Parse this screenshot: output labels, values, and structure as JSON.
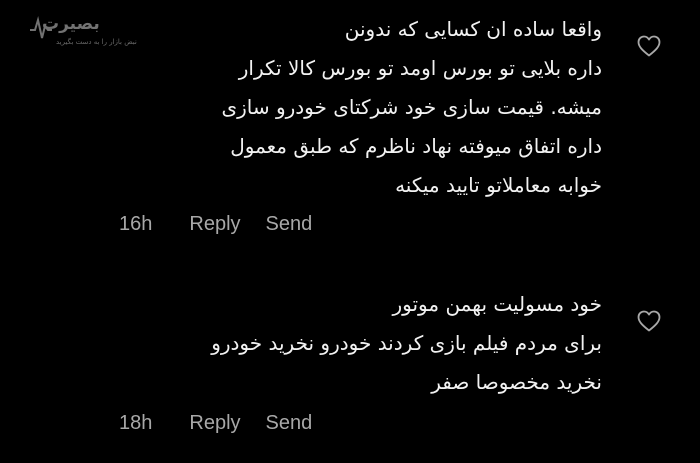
{
  "watermark": {
    "brand": "بصیرت",
    "tagline": "نبض بازار را به دست بگیرید"
  },
  "comments": [
    {
      "lines": [
        "واقعا ساده ان کسایی که ندونن",
        "داره بلایی تو بورس اومد تو بورس کالا تکرار",
        "میشه. قیمت سازی خود شرکتای خودرو سازی",
        "داره اتفاق میوفته نهاد ناظرم که طبق معمول",
        "خوابه معاملاتو تایید میکنه"
      ],
      "time": "16h",
      "reply_label": "Reply",
      "send_label": "Send"
    },
    {
      "lines": [
        "خود مسولیت بهمن موتور",
        "برای مردم فیلم بازی کردند خودرو نخرید خودرو",
        "نخرید مخصوصا صفر"
      ],
      "time": "18h",
      "reply_label": "Reply",
      "send_label": "Send"
    }
  ],
  "icons": {
    "like": "heart-outline-icon"
  },
  "colors": {
    "background": "#000000",
    "text": "#f2f2f2",
    "meta": "#a8a8a8"
  }
}
